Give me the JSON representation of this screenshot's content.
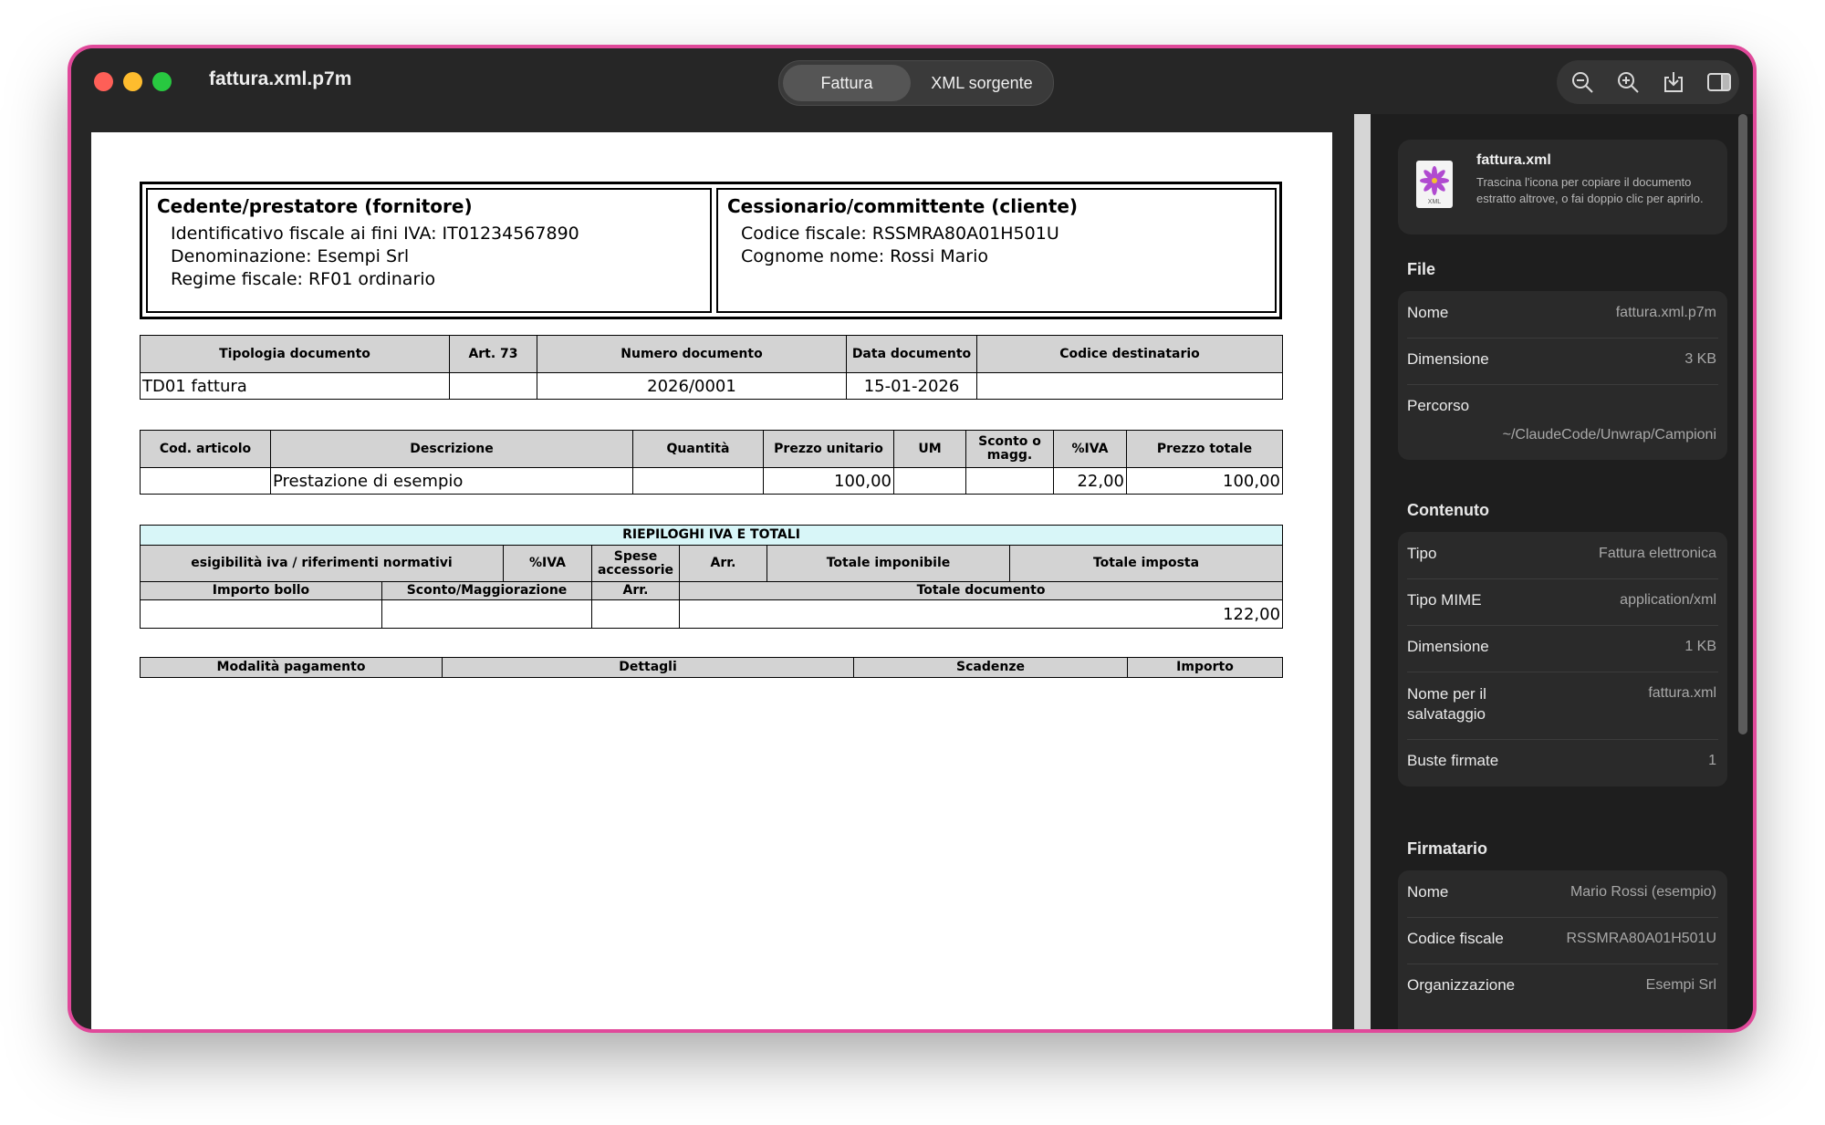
{
  "window": {
    "title": "fattura.xml.p7m"
  },
  "tabs": [
    {
      "label": "Fattura",
      "selected": true
    },
    {
      "label": "XML sorgente",
      "selected": false
    }
  ],
  "toolbar": {
    "icons": [
      "zoom-out-icon",
      "zoom-in-icon",
      "save-icon",
      "sidebar-toggle-icon"
    ]
  },
  "invoice": {
    "cedente": {
      "header": "Cedente/prestatore (fornitore)",
      "lines": [
        "Identificativo fiscale ai fini IVA: IT01234567890",
        "Denominazione: Esempi Srl",
        "Regime fiscale: RF01 ordinario"
      ]
    },
    "cessionario": {
      "header": "Cessionario/committente (cliente)",
      "lines": [
        "Codice fiscale: RSSMRA80A01H501U",
        "Cognome nome: Rossi Mario"
      ]
    },
    "doc_table": {
      "headers": [
        "Tipologia documento",
        "Art. 73",
        "Numero documento",
        "Data documento",
        "Codice destinatario"
      ],
      "row": [
        "TD01 fattura",
        "",
        "2026/0001",
        "15-01-2026",
        ""
      ]
    },
    "lines_table": {
      "headers": [
        "Cod. articolo",
        "Descrizione",
        "Quantità",
        "Prezzo unitario",
        "UM",
        "Sconto o magg.",
        "%IVA",
        "Prezzo totale"
      ],
      "row": [
        "",
        "Prestazione di esempio",
        "",
        "100,00",
        "",
        "",
        "22,00",
        "100,00"
      ]
    },
    "summary": {
      "title": "RIEPILOGHI IVA E TOTALI",
      "headers1": [
        "esigibilità iva / riferimenti normativi",
        "%IVA",
        "Spese accessorie",
        "Arr.",
        "Totale imponibile",
        "Totale imposta"
      ],
      "headers2": [
        "Importo bollo",
        "Sconto/Maggiorazione",
        "Arr.",
        "Totale documento"
      ],
      "row": [
        "",
        "",
        "",
        "122,00"
      ]
    },
    "payment_table": {
      "headers": [
        "Modalità pagamento",
        "Dettagli",
        "Scadenze",
        "Importo"
      ]
    }
  },
  "sidebar": {
    "file_card": {
      "name": "fattura.xml",
      "icon_label": "XML",
      "description": "Trascina l'icona per copiare il documento estratto altrove, o fai doppio clic per aprirlo."
    },
    "file_section": {
      "title": "File",
      "rows": [
        {
          "key": "Nome",
          "value": "fattura.xml.p7m"
        },
        {
          "key": "Dimensione",
          "value": "3 KB"
        },
        {
          "key": "Percorso",
          "value": "~/ClaudeCode/Unwrap/Campioni"
        }
      ]
    },
    "content_section": {
      "title": "Contenuto",
      "rows": [
        {
          "key": "Tipo",
          "value": "Fattura elettronica"
        },
        {
          "key": "Tipo MIME",
          "value": "application/xml"
        },
        {
          "key": "Dimensione",
          "value": "1 KB"
        },
        {
          "key": "Nome per il salvataggio",
          "value": "fattura.xml"
        },
        {
          "key": "Buste firmate",
          "value": "1"
        }
      ]
    },
    "signer_section": {
      "title": "Firmatario",
      "rows": [
        {
          "key": "Nome",
          "value": "Mario Rossi (esempio)"
        },
        {
          "key": "Codice fiscale",
          "value": "RSSMRA80A01H501U"
        },
        {
          "key": "Organizzazione",
          "value": "Esempi Srl"
        }
      ]
    }
  }
}
